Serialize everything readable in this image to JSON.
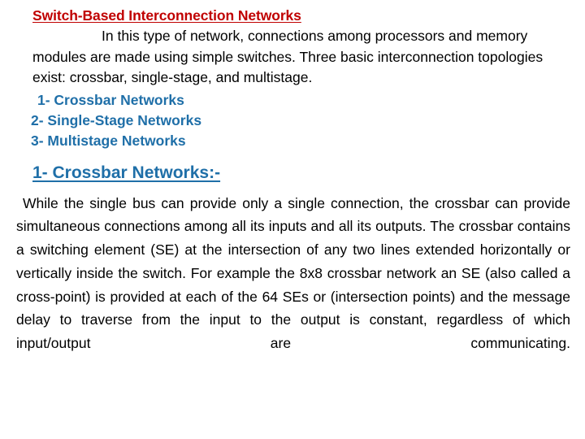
{
  "slide": {
    "background_color": "#FFFFFF",
    "title_color": "#C00000",
    "accent_color": "#1F6FA8",
    "body_color": "#000000"
  },
  "section_title": "Switch-Based Interconnection Networks",
  "intro_paragraph": "In this type of network, connections among processors and memory modules are made using simple switches. Three basic interconnection topologies exist: crossbar, single-stage, and multistage.",
  "topics": [
    {
      "label": "1- Crossbar Networks"
    },
    {
      "label": "2- Single-Stage Networks"
    },
    {
      "label": "3- Multistage Networks"
    }
  ],
  "sub_heading": "1- Crossbar Networks:-",
  "body_paragraph": "While the single bus can provide only a single connection, the crossbar can provide simultaneous connections among all its inputs and all its outputs. The crossbar contains a switching element (SE) at the intersection of any two lines extended horizontally or vertically inside the switch. For example the 8x8 crossbar network an SE (also called a cross-point) is provided at each of the 64 SEs or (intersection points) and the message delay to traverse from the input to the output is constant, regardless of which input/output are communicating."
}
